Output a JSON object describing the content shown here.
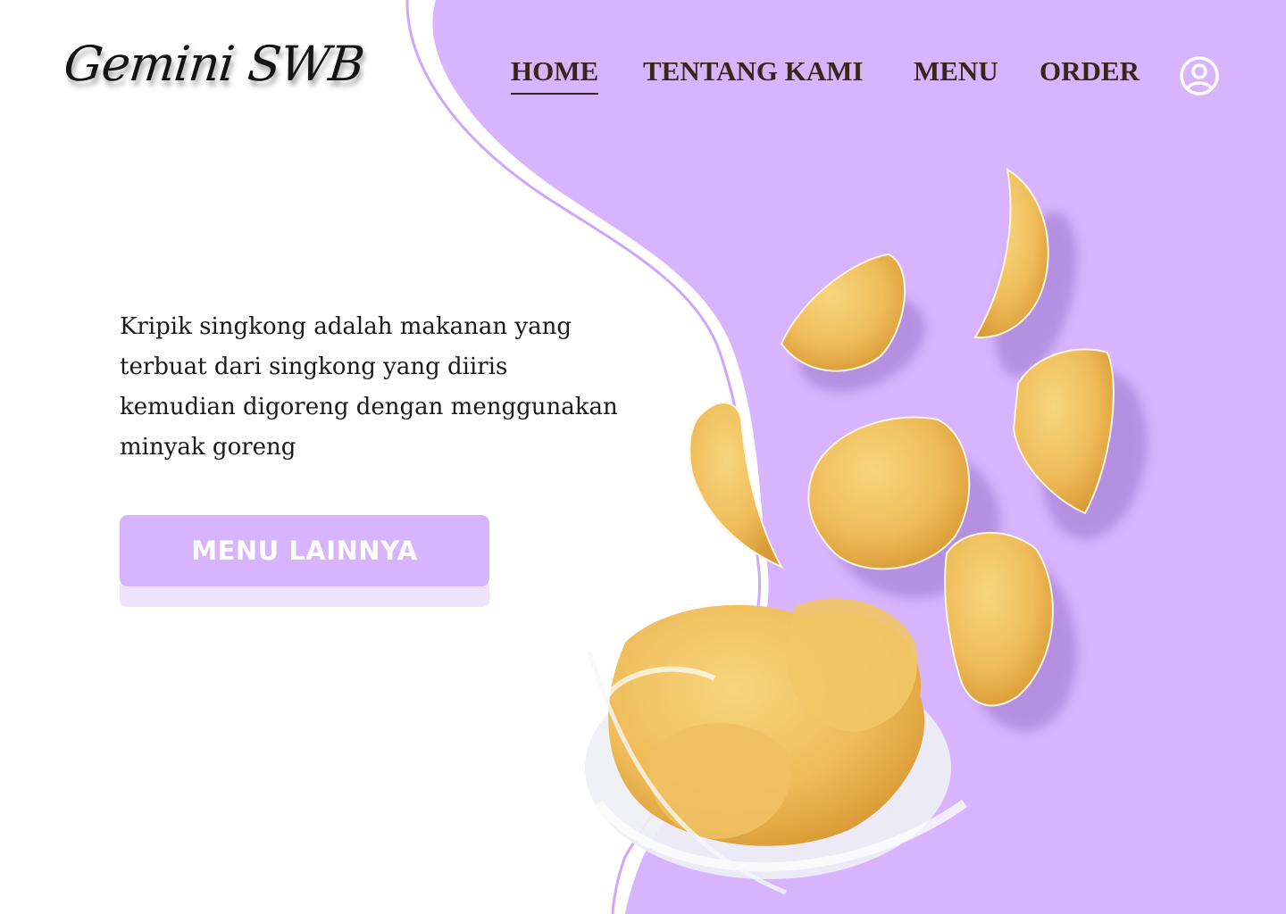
{
  "brand": {
    "logo_text": "Gemini SWB"
  },
  "nav": {
    "items": [
      {
        "label": "HOME",
        "active": true
      },
      {
        "label": "TENTANG KAMI",
        "active": false
      },
      {
        "label": "MENU",
        "active": false
      },
      {
        "label": "ORDER",
        "active": false
      }
    ],
    "profile_icon": "user-circle-icon"
  },
  "hero": {
    "description": "Kripik singkong adalah makanan yang terbuat dari singkong yang diiris kemudian digoreng dengan menggunakan minyak goreng",
    "cta_label": "MENU LAINNYA"
  },
  "colors": {
    "accent": "#d8b4ff",
    "accent_light": "#efe2ff",
    "nav_text": "#3b2418",
    "chip": "#f2c15f",
    "chip_dark": "#d99a35"
  },
  "images": {
    "hero_image": "potato-chips-in-glass-bowl"
  }
}
